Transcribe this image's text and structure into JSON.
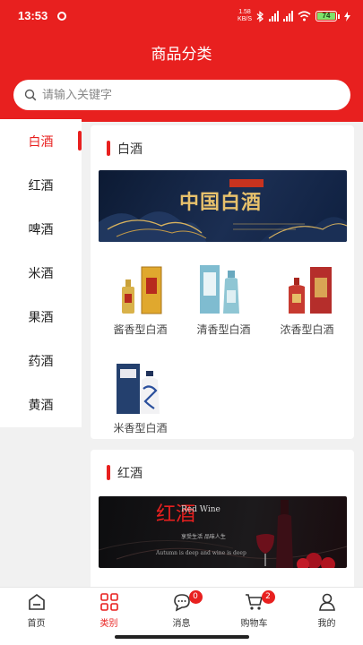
{
  "status_bar": {
    "time": "13:53",
    "speed_value": "1.58",
    "speed_unit": "KB/S",
    "battery": "74"
  },
  "header": {
    "title": "商品分类"
  },
  "search": {
    "placeholder": "请输入关键字"
  },
  "sidebar": {
    "items": [
      {
        "label": "白酒",
        "active": true
      },
      {
        "label": "红酒"
      },
      {
        "label": "啤酒"
      },
      {
        "label": "米酒"
      },
      {
        "label": "果酒"
      },
      {
        "label": "药酒"
      },
      {
        "label": "黄酒"
      }
    ]
  },
  "sections": [
    {
      "title": "白酒",
      "banner_title": "中国白酒",
      "products": [
        {
          "label": "酱香型白酒"
        },
        {
          "label": "清香型白酒"
        },
        {
          "label": "浓香型白酒"
        },
        {
          "label": "米香型白酒"
        }
      ]
    },
    {
      "title": "红酒",
      "banner_title": "红酒",
      "banner_subtitle": "Red Wine",
      "banner_tagline": "享受生活 品味人生",
      "banner_en": "Autumn is deep and wine is deep"
    }
  ],
  "tabbar": {
    "tabs": [
      {
        "label": "首页",
        "icon": "home-icon"
      },
      {
        "label": "类别",
        "icon": "category-icon",
        "active": true
      },
      {
        "label": "消息",
        "icon": "message-icon",
        "badge": "0"
      },
      {
        "label": "购物车",
        "icon": "cart-icon",
        "badge": "2"
      },
      {
        "label": "我的",
        "icon": "profile-icon"
      }
    ]
  },
  "colors": {
    "accent": "#e8201f"
  }
}
